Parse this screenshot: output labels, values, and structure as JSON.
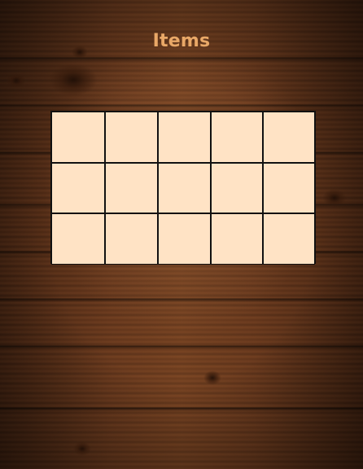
{
  "inventory": {
    "title": "Items",
    "rows": 3,
    "columns": 5,
    "slots": [
      {
        "row": 1,
        "col": 1,
        "item": ""
      },
      {
        "row": 1,
        "col": 2,
        "item": ""
      },
      {
        "row": 1,
        "col": 3,
        "item": ""
      },
      {
        "row": 1,
        "col": 4,
        "item": ""
      },
      {
        "row": 1,
        "col": 5,
        "item": ""
      },
      {
        "row": 2,
        "col": 1,
        "item": ""
      },
      {
        "row": 2,
        "col": 2,
        "item": ""
      },
      {
        "row": 2,
        "col": 3,
        "item": ""
      },
      {
        "row": 2,
        "col": 4,
        "item": ""
      },
      {
        "row": 2,
        "col": 5,
        "item": ""
      },
      {
        "row": 3,
        "col": 1,
        "item": ""
      },
      {
        "row": 3,
        "col": 2,
        "item": ""
      },
      {
        "row": 3,
        "col": 3,
        "item": ""
      },
      {
        "row": 3,
        "col": 4,
        "item": ""
      },
      {
        "row": 3,
        "col": 5,
        "item": ""
      }
    ]
  },
  "colors": {
    "title": "#e9a867",
    "slot_fill": "#ffe3c5",
    "slot_border": "#111111",
    "wood": "#4a2a17"
  }
}
